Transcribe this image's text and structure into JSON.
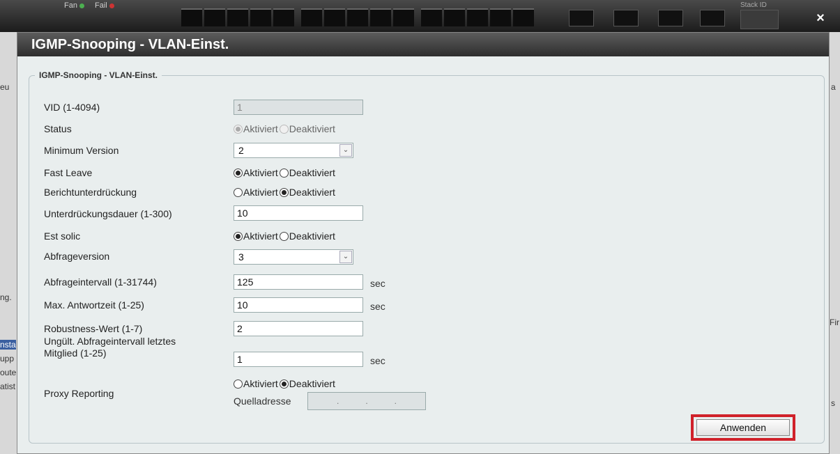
{
  "background": {
    "fan_label": "Fan",
    "fail_label": "Fail",
    "stack_label": "Stack ID",
    "left_fragments": [
      "eu",
      "ng.",
      "nsta",
      "upp",
      "oute",
      "atist"
    ],
    "right_fragments": [
      "a",
      "Fir",
      "s"
    ]
  },
  "dialog": {
    "title": "IGMP-Snooping - VLAN-Einst.",
    "close_symbol": "×",
    "panel_legend": "IGMP-Snooping - VLAN-Einst.",
    "fields": {
      "vid": {
        "label": "VID (1-4094)",
        "value": "1"
      },
      "status": {
        "label": "Status",
        "opt1": "Aktiviert",
        "opt2": "Deaktiviert",
        "selected": "Aktiviert"
      },
      "min_version": {
        "label": "Minimum Version",
        "value": "2"
      },
      "fast_leave": {
        "label": "Fast Leave",
        "opt1": "Aktiviert",
        "opt2": "Deaktiviert",
        "selected": "Aktiviert"
      },
      "report_suppression": {
        "label": "Berichtunterdrückung",
        "opt1": "Aktiviert",
        "opt2": "Deaktiviert",
        "selected": "Deaktiviert"
      },
      "suppression_time": {
        "label": "Unterdrückungsdauer (1-300)",
        "value": "10"
      },
      "est_solic": {
        "label": "Est solic",
        "opt1": "Aktiviert",
        "opt2": "Deaktiviert",
        "selected": "Aktiviert"
      },
      "query_version": {
        "label": "Abfrageversion",
        "value": "3"
      },
      "query_interval": {
        "label": "Abfrageintervall (1-31744)",
        "value": "125",
        "unit": "sec"
      },
      "max_response": {
        "label": "Max. Antwortzeit (1-25)",
        "value": "10",
        "unit": "sec"
      },
      "robustness": {
        "label": "Robustness-Wert (1-7)",
        "value": "2"
      },
      "last_member_interval": {
        "label_line1": "Ungült. Abfrageintervall letztes",
        "label_line2": "Mitglied (1-25)",
        "value": "1",
        "unit": "sec"
      },
      "proxy_reporting": {
        "label": "Proxy Reporting",
        "opt1": "Aktiviert",
        "opt2": "Deaktiviert",
        "selected": "Deaktiviert",
        "source_label": "Quelladresse",
        "ip_dots": [
          ".",
          ".",
          "."
        ]
      }
    },
    "apply_label": "Anwenden",
    "highlight_color": "#d0212a"
  }
}
